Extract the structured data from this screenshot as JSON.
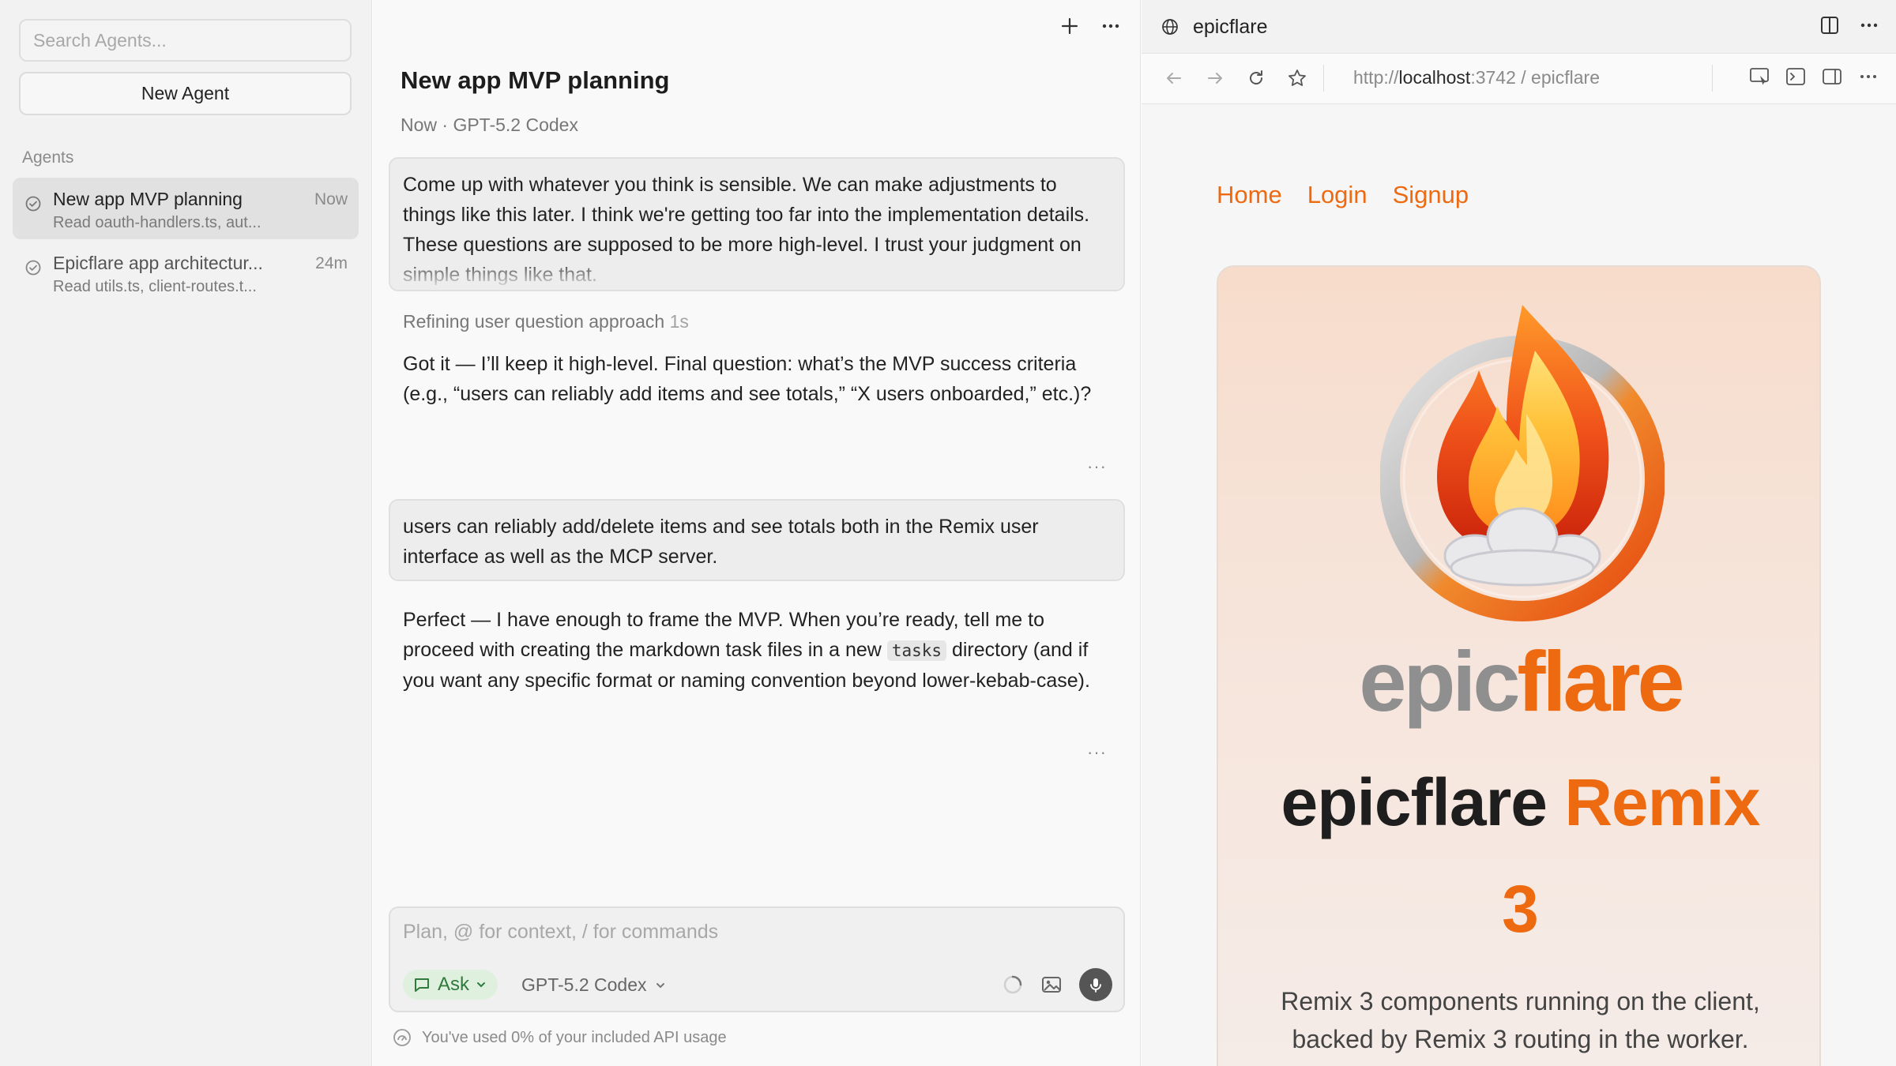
{
  "sidebar": {
    "search_placeholder": "Search Agents...",
    "new_agent_label": "New Agent",
    "section_label": "Agents",
    "items": [
      {
        "title": "New app MVP planning",
        "time": "Now",
        "subtitle": "Read oauth-handlers.ts, aut...",
        "active": true
      },
      {
        "title": "Epicflare app architectur...",
        "time": "24m",
        "subtitle": "Read utils.ts, client-routes.t...",
        "active": false
      }
    ]
  },
  "chat": {
    "title": "New app MVP planning",
    "meta": "Now · GPT-5.2 Codex",
    "messages": [
      {
        "role": "user",
        "text": "Come up with whatever you think is sensible. We can make adjustments to things like this later. I think we're getting too far into the implementation details. These questions are supposed to be more high-level. I trust your judgment on simple things like that."
      },
      {
        "role": "thinking",
        "text": "Refining user question approach",
        "duration": "1s"
      },
      {
        "role": "assistant",
        "text": "Got it — I’ll keep it high-level. Final question: what’s the MVP success criteria (e.g., “users can reliably add items and see totals,” “X users onboarded,” etc.)?"
      },
      {
        "role": "user",
        "text": "users can reliably add/delete items and see totals both in the Remix user interface as well as the MCP server."
      },
      {
        "role": "assistant",
        "text_before": "Perfect — I have enough to frame the MVP. When you’re ready, tell me to proceed with creating the markdown task files in a new ",
        "code": "tasks",
        "text_after": " directory (and if you want any specific format or naming convention beyond lower-kebab-case)."
      }
    ],
    "more_dots": "···",
    "composer": {
      "placeholder": "Plan, @ for context, / for commands",
      "mode_label": "Ask",
      "model_label": "GPT-5.2 Codex"
    },
    "usage_text": "You've used 0% of your included API usage"
  },
  "browser": {
    "tab_title": "epicflare",
    "url_prefix": "http://",
    "url_host": "localhost",
    "url_rest": ":3742 / epicflare",
    "site_nav": [
      "Home",
      "Login",
      "Signup"
    ],
    "wordmark_epic": "epic",
    "wordmark_flare": "flare",
    "hero_title_main": "epicflare ",
    "hero_title_accent": "Remix",
    "hero_number": "3",
    "hero_description": "Remix 3 components running on the client, backed by Remix 3 routing in the worker."
  },
  "colors": {
    "accent": "#ee6a10",
    "ask_pill_bg": "#dff0df",
    "ask_pill_text": "#2f7a3c"
  },
  "icons": [
    "check-circle-icon",
    "plus-icon",
    "more-horizontal-icon",
    "globe-icon",
    "split-view-icon",
    "back-arrow-icon",
    "forward-arrow-icon",
    "reload-icon",
    "star-icon",
    "inspect-icon",
    "terminal-icon",
    "sidebar-icon",
    "chat-bubble-icon",
    "chevron-down-icon",
    "spinner-icon",
    "image-icon",
    "microphone-icon",
    "usage-gauge-icon"
  ]
}
